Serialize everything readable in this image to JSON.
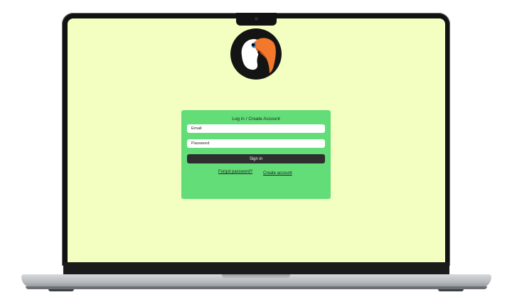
{
  "app": {
    "background_color": "#f2ffc0",
    "brand_logo": "toucan-logo"
  },
  "login": {
    "title": "Log in / Create Account",
    "email_placeholder": "Email",
    "email_value": "",
    "password_placeholder": "Password",
    "password_value": "",
    "sign_in_label": "Sign in",
    "forgot_password_label": "Forgot password?",
    "create_account_label": "Create account",
    "card_color": "#62dd78",
    "button_color": "#2e2e2e"
  }
}
